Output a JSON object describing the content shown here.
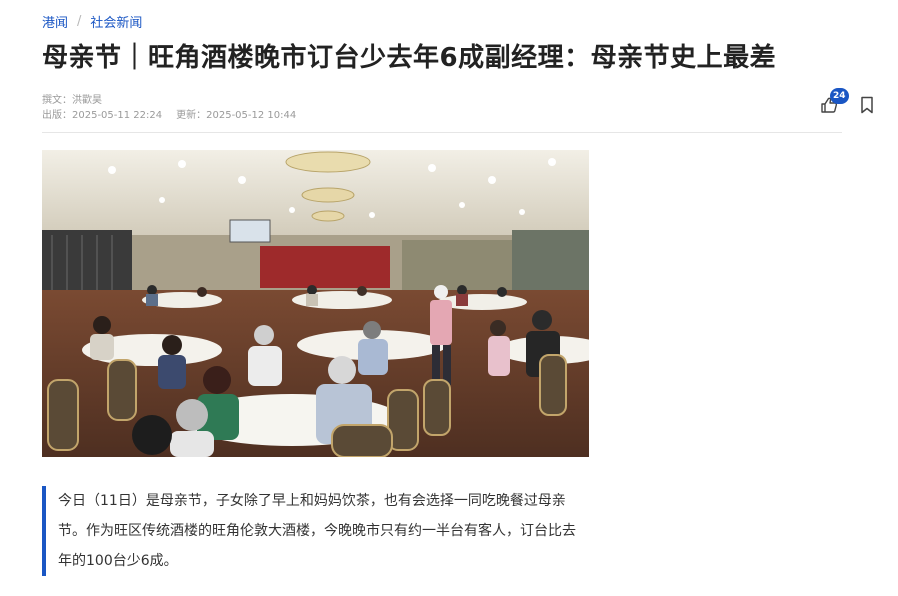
{
  "breadcrumb": {
    "items": [
      "港闻",
      "社会新闻"
    ],
    "separator": "/"
  },
  "article": {
    "headline": "母亲节｜旺角酒楼晚市订台少去年6成副经理：母亲节史上最差",
    "reporter_line": "撰文：洪歡昊",
    "published_label": "出版：2025-05-11 22:24",
    "updated_label": "更新：2025-05-12 10:44",
    "summary": "今日（11日）是母亲节，子女除了早上和妈妈饮茶，也有会选择一同吃晚餐过母亲节。作为旺区传统酒楼的旺角伦敦大酒楼，今晚晚市只有约一半台有客人，订台比去年的100台少6成。"
  },
  "actions": {
    "like_count": "24",
    "like_icon": "thumbs-up-icon",
    "bookmark_icon": "bookmark-icon"
  },
  "colors": {
    "accent": "#1a56c4",
    "meta_text": "#9a9a9a",
    "carpet": "#6b3f2a",
    "curtain": "#9e2a2b"
  }
}
